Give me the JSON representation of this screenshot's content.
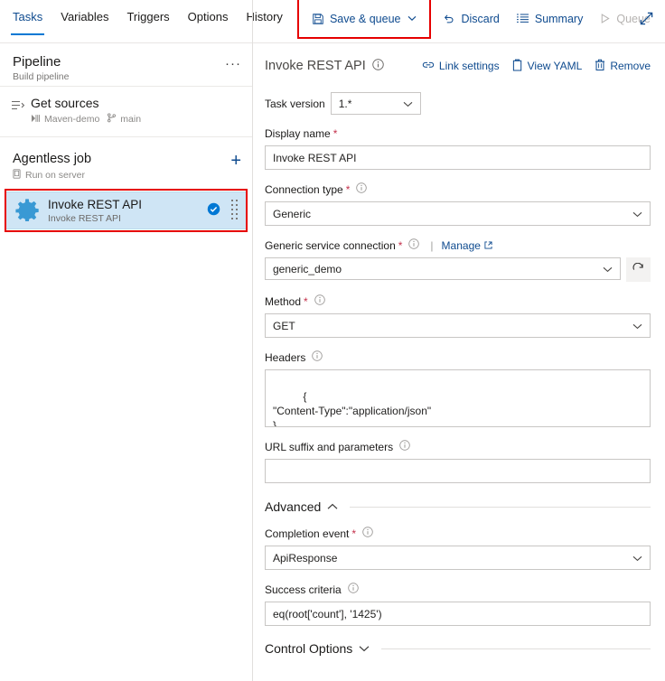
{
  "toolbar": {
    "tabs": [
      {
        "label": "Tasks",
        "active": true
      },
      {
        "label": "Variables",
        "active": false
      },
      {
        "label": "Triggers",
        "active": false
      },
      {
        "label": "Options",
        "active": false
      },
      {
        "label": "History",
        "active": false
      }
    ],
    "save_queue_label": "Save & queue",
    "discard_label": "Discard",
    "summary_label": "Summary",
    "queue_label": "Queue",
    "overflow_label": "···",
    "highlight_color": "#e60000",
    "accent_color": "#0078d4",
    "link_color": "#0f4b8f"
  },
  "sidebar": {
    "pipeline": {
      "title": "Pipeline",
      "subtitle": "Build pipeline",
      "more_label": "···"
    },
    "get_sources": {
      "title": "Get sources",
      "repo": "Maven-demo",
      "branch": "main"
    },
    "job": {
      "title": "Agentless job",
      "subtitle": "Run on server",
      "add_label": "+"
    },
    "task": {
      "name": "Invoke REST API",
      "subtitle": "Invoke REST API",
      "selected": true,
      "enabled_check": true
    }
  },
  "main": {
    "title": "Invoke REST API",
    "links": [
      {
        "label": "Link settings",
        "icon": "link-icon"
      },
      {
        "label": "View YAML",
        "icon": "clipboard-icon"
      },
      {
        "label": "Remove",
        "icon": "trash-icon"
      }
    ],
    "task_version": {
      "label": "Task version",
      "value": "1.*"
    },
    "fields": {
      "display_name": {
        "label": "Display name",
        "required": true,
        "value": "Invoke REST API"
      },
      "connection_type": {
        "label": "Connection type",
        "required": true,
        "value": "Generic"
      },
      "service_connection": {
        "label": "Generic service connection",
        "required": true,
        "manage_label": "Manage",
        "value": "generic_demo",
        "refresh_icon": "refresh-icon"
      },
      "method": {
        "label": "Method",
        "required": true,
        "value": "GET"
      },
      "headers": {
        "label": "Headers",
        "required": false,
        "value": "{\n\"Content-Type\":\"application/json\"\n}"
      },
      "url_suffix": {
        "label": "URL suffix and parameters",
        "required": false,
        "value": ""
      },
      "completion_event": {
        "label": "Completion event",
        "required": true,
        "value": "ApiResponse"
      },
      "success_criteria": {
        "label": "Success criteria",
        "required": false,
        "value": "eq(root['count'], '1425')"
      }
    },
    "sections": {
      "advanced": {
        "label": "Advanced",
        "expanded": true
      },
      "control_options": {
        "label": "Control Options",
        "expanded": false
      }
    }
  }
}
